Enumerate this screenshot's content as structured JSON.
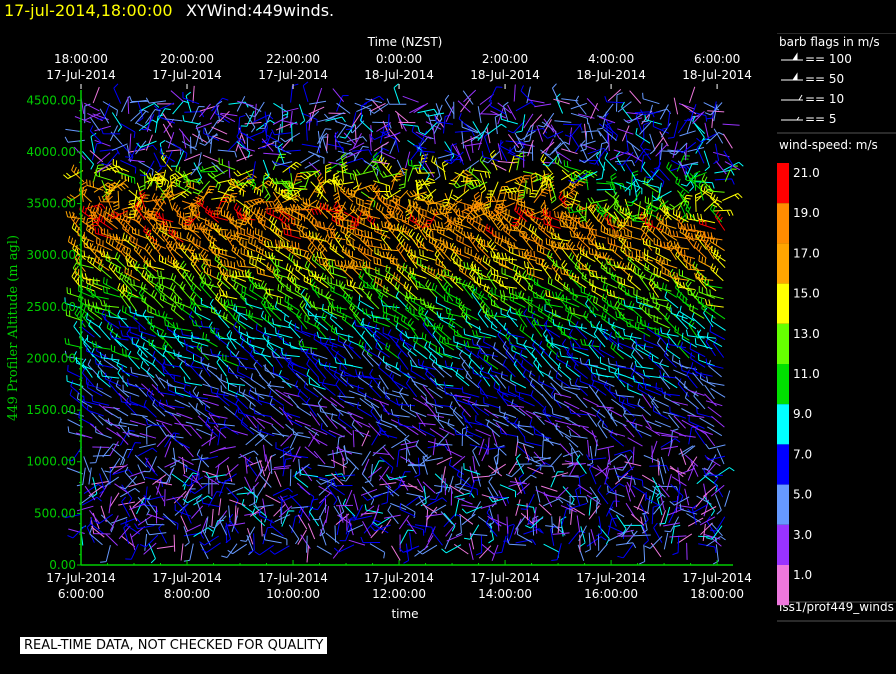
{
  "header": {
    "datetime": "17-jul-2014,18:00:00",
    "title": "XYWind:449winds."
  },
  "chart_data": {
    "type": "wind-barb",
    "top_axis_title": "Time (NZST)",
    "top_ticks": [
      {
        "time": "18:00:00",
        "date": "17-Jul-2014"
      },
      {
        "time": "20:00:00",
        "date": "17-Jul-2014"
      },
      {
        "time": "22:00:00",
        "date": "17-Jul-2014"
      },
      {
        "time": "0:00:00",
        "date": "18-Jul-2014"
      },
      {
        "time": "2:00:00",
        "date": "18-Jul-2014"
      },
      {
        "time": "4:00:00",
        "date": "18-Jul-2014"
      },
      {
        "time": "6:00:00",
        "date": "18-Jul-2014"
      }
    ],
    "bottom_ticks": [
      {
        "date": "17-Jul-2014",
        "time": "6:00:00"
      },
      {
        "date": "17-Jul-2014",
        "time": "8:00:00"
      },
      {
        "date": "17-Jul-2014",
        "time": "10:00:00"
      },
      {
        "date": "17-Jul-2014",
        "time": "12:00:00"
      },
      {
        "date": "17-Jul-2014",
        "time": "14:00:00"
      },
      {
        "date": "17-Jul-2014",
        "time": "16:00:00"
      },
      {
        "date": "17-Jul-2014",
        "time": "18:00:00"
      }
    ],
    "xlabel": "time",
    "ylabel": "449 Profiler Altitude (m agl)",
    "y_ticks": [
      "4500.00",
      "4000.00",
      "3500.00",
      "3000.00",
      "2500.00",
      "2000.00",
      "1500.00",
      "1000.00",
      "500.00",
      "0.00"
    ],
    "ylim": [
      0,
      4600
    ],
    "xlim_hours_utc": [
      6,
      18.3
    ],
    "speed_profile": [
      {
        "altitude": 500,
        "speed": 4
      },
      {
        "altitude": 1000,
        "speed": 4
      },
      {
        "altitude": 1500,
        "speed": 5
      },
      {
        "altitude": 1800,
        "speed": 7
      },
      {
        "altitude": 2200,
        "speed": 9
      },
      {
        "altitude": 2600,
        "speed": 13
      },
      {
        "altitude": 3000,
        "speed": 17
      },
      {
        "altitude": 3400,
        "speed": 19
      },
      {
        "altitude": 4000,
        "speed": 11
      }
    ]
  },
  "barb_legend": {
    "title": "barb flags in m/s",
    "items": [
      {
        "speed": 100,
        "label": "== 100"
      },
      {
        "speed": 50,
        "label": "== 50"
      },
      {
        "speed": 10,
        "label": "== 10"
      },
      {
        "speed": 5,
        "label": "== 5"
      }
    ]
  },
  "speed_legend": {
    "title": "wind-speed: m/s",
    "levels": [
      {
        "label": "21.0",
        "color": "#ff0000"
      },
      {
        "label": "19.0",
        "color": "#ff8c00"
      },
      {
        "label": "17.0",
        "color": "#ffa500"
      },
      {
        "label": "15.0",
        "color": "#ffff00"
      },
      {
        "label": "13.0",
        "color": "#66ff00"
      },
      {
        "label": "11.0",
        "color": "#00e000"
      },
      {
        "label": "9.0",
        "color": "#00ffff"
      },
      {
        "label": "7.0",
        "color": "#0000ff"
      },
      {
        "label": "5.0",
        "color": "#6699ff"
      },
      {
        "label": "3.0",
        "color": "#9933ff"
      },
      {
        "label": "1.0",
        "color": "#ee77dd"
      }
    ]
  },
  "data_source": "iss1/prof449_winds",
  "notice": "REAL-TIME DATA, NOT CHECKED FOR QUALITY",
  "colors": {
    "axis": "#00cc00",
    "title_date": "#ffff00",
    "background": "#000000"
  }
}
